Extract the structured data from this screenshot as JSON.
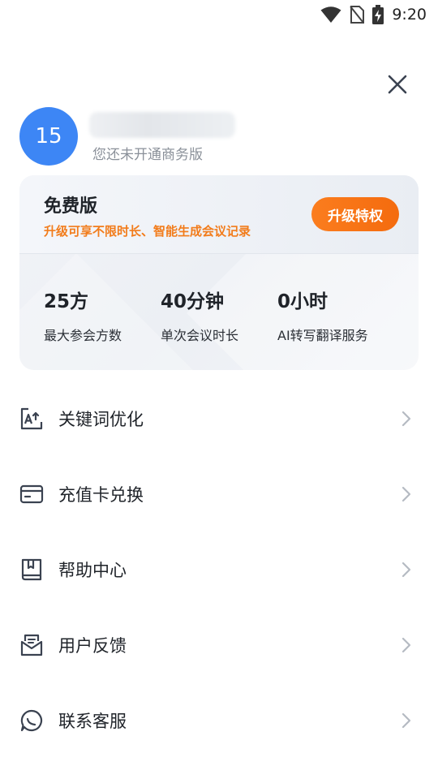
{
  "status_bar": {
    "time": "9:20"
  },
  "profile": {
    "avatar_text": "15",
    "subscription_status": "您还未开通商务版"
  },
  "plan": {
    "title": "免费版",
    "description": "升级可享不限时长、智能生成会议记录",
    "upgrade_label": "升级特权",
    "stats": [
      {
        "value": "25方",
        "label": "最大参会方数"
      },
      {
        "value": "40分钟",
        "label": "单次会议时长"
      },
      {
        "value": "0小时",
        "label": "AI转写翻译服务"
      }
    ]
  },
  "menu": [
    {
      "label": "关键词优化",
      "icon": "keyword-icon"
    },
    {
      "label": "充值卡兑换",
      "icon": "card-icon"
    },
    {
      "label": "帮助中心",
      "icon": "book-icon"
    },
    {
      "label": "用户反馈",
      "icon": "feedback-icon"
    },
    {
      "label": "联系客服",
      "icon": "chat-icon"
    }
  ],
  "colors": {
    "accent_orange": "#f57214",
    "avatar_blue": "#3d86f5",
    "icon_color": "#3a4250",
    "chevron_color": "#b5bac2"
  }
}
